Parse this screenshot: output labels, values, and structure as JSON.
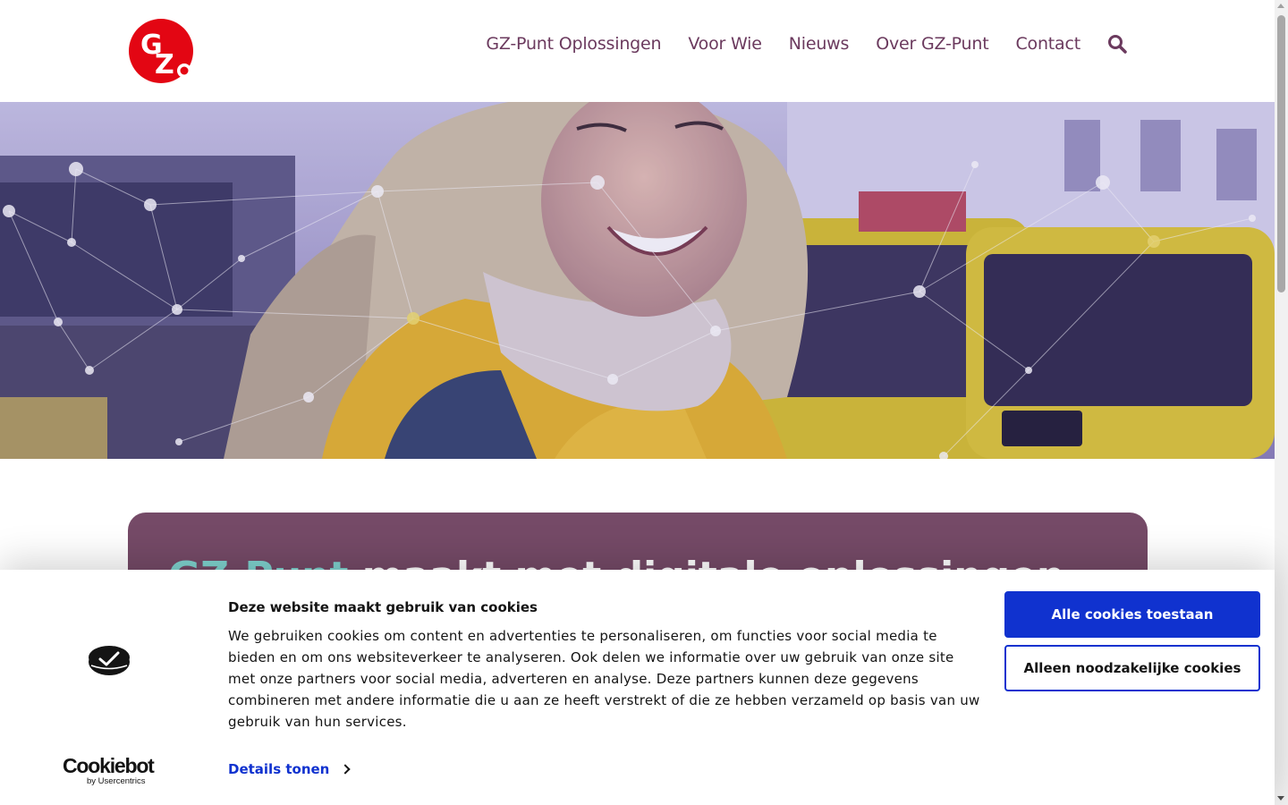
{
  "brand": {
    "logo_letters": "GZ",
    "logo_color": "#e30613"
  },
  "nav": {
    "items": [
      "GZ-Punt Oplossingen",
      "Voor Wie",
      "Nieuws",
      "Over GZ-Punt",
      "Contact"
    ],
    "search_icon": "search-icon",
    "color": "#6b3a5e"
  },
  "hero": {
    "image_description_icon": "hero-photo"
  },
  "card": {
    "title_accent": "GZ-Punt",
    "title_rest": " maakt met digitale oplossingen",
    "background": "#754a67",
    "accent_color": "#7fd3cf"
  },
  "cookie_banner": {
    "title": "Deze website maakt gebruik van cookies",
    "text": "We gebruiken cookies om content en advertenties te personaliseren, om functies voor social media te bieden en om ons websiteverkeer te analyseren. Ook delen we informatie over uw gebruik van onze site met onze partners voor social media, adverteren en analyse. Deze partners kunnen deze gegevens combineren met andere informatie die u aan ze heeft verstrekt of die ze hebben verzameld op basis van uw gebruik van hun services.",
    "details_link": "Details tonen",
    "accept_all": "Alle cookies toestaan",
    "necessary_only": "Alleen noodzakelijke cookies",
    "provider_name": "Cookiebot",
    "provider_sub": "by Usercentrics",
    "accent_color": "#1032cf"
  }
}
